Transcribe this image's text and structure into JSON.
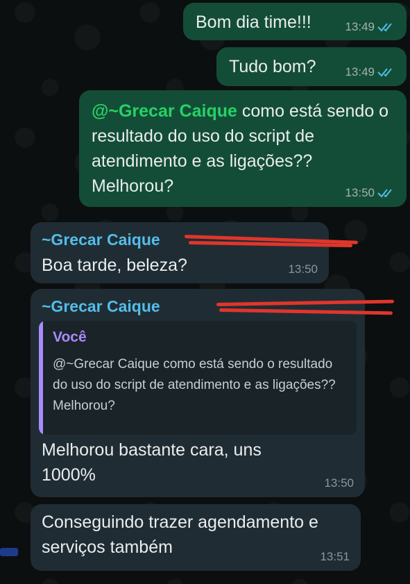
{
  "messages": {
    "m1": {
      "text": "Bom dia time!!!",
      "time": "13:49",
      "status": "read"
    },
    "m2": {
      "text": "Tudo bom?",
      "time": "13:49",
      "status": "read"
    },
    "m3": {
      "mention": "@~Grecar Caique",
      "text": " como está sendo o resultado do uso do script de atendimento e as ligações?? Melhorou?",
      "time": "13:50",
      "status": "read"
    },
    "m4": {
      "sender": "~Grecar Caique",
      "text": "Boa tarde, beleza?",
      "time": "13:50"
    },
    "m5": {
      "sender": "~Grecar Caique",
      "quote": {
        "author": "Você",
        "text": "@~Grecar Caique como está sendo o resultado do uso do script de atendimento e as ligações?? Melhorou?"
      },
      "text": "Melhorou bastante cara, uns 1000%",
      "time": "13:50"
    },
    "m6": {
      "text": "Conseguindo trazer agendamento e serviços também",
      "time": "13:51"
    }
  },
  "colors": {
    "outgoing_bubble": "#144d37",
    "incoming_bubble": "#202c33",
    "mention": "#25d366",
    "sender": "#53bdeb",
    "quote_author": "#a78bfa",
    "redaction": "#e0362c",
    "read_ticks": "#53bdeb"
  },
  "icons": {
    "read_receipt": "double-check-icon"
  }
}
